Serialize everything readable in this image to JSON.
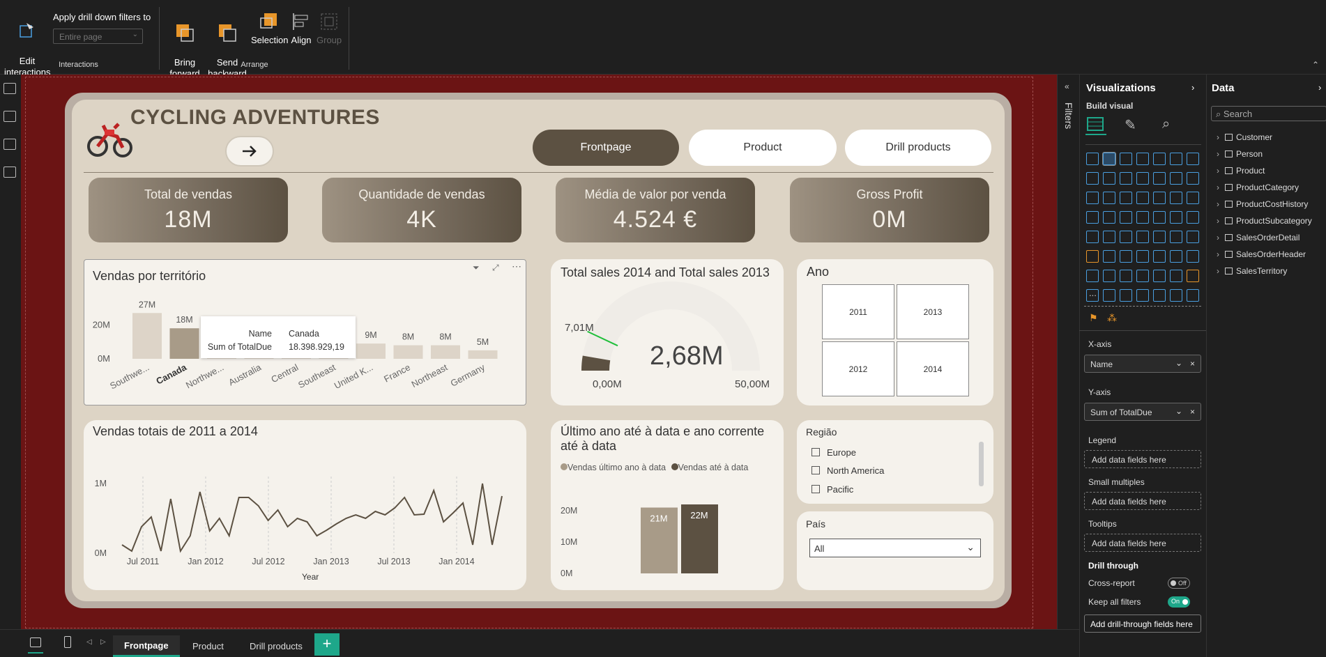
{
  "ribbon": {
    "edit_interactions": "Edit\ninteractions",
    "apply_drill": "Apply drill down filters to",
    "drill_placeholder": "Entire page",
    "interactions_group": "Interactions",
    "bring_forward": "Bring\nforward",
    "send_backward": "Send\nbackward",
    "selection": "Selection",
    "align": "Align",
    "group": "Group",
    "arrange_group": "Arrange"
  },
  "report": {
    "title": "CYCLING ADVENTURES",
    "nav": [
      "Frontpage",
      "Product",
      "Drill products"
    ],
    "kpis": [
      {
        "label": "Total de vendas",
        "value": "18M"
      },
      {
        "label": "Quantidade de vendas",
        "value": "4K"
      },
      {
        "label": "Média de valor por venda",
        "value": "4.524 €"
      },
      {
        "label": "Gross Profit",
        "value": "0M"
      }
    ],
    "bar_chart": {
      "title": "Vendas por território",
      "tooltip": {
        "name_label": "Name",
        "name_value": "Canada",
        "sum_label": "Sum of TotalDue",
        "sum_value": "18.398.929,19"
      }
    },
    "gauge": {
      "title": "Total sales 2014 and Total sales 2013",
      "value_label": "2,68M",
      "target_label": "7,01M",
      "min_label": "0,00M",
      "max_label": "50,00M"
    },
    "ano_slicer": {
      "title": "Ano",
      "options": [
        "2011",
        "2013",
        "2012",
        "2014"
      ]
    },
    "line_chart": {
      "title": "Vendas totais de 2011 a 2014",
      "xlabel": "Year"
    },
    "ytd_chart": {
      "title": "Último ano até à data e ano corrente até à data",
      "legend": [
        "Vendas último ano à data",
        "Vendas até à data"
      ]
    },
    "regiao": {
      "title": "Região",
      "options": [
        "Europe",
        "North America",
        "Pacific"
      ]
    },
    "pais": {
      "title": "País",
      "value": "All"
    }
  },
  "chart_data": [
    {
      "type": "bar",
      "title": "Vendas por território",
      "categories": [
        "Southwe...",
        "Canada",
        "Northwe...",
        "Australia",
        "Central",
        "Southeast",
        "United K...",
        "France",
        "Northeast",
        "Germany"
      ],
      "values": [
        27,
        18,
        18,
        12,
        9,
        9,
        9,
        8,
        8,
        5
      ],
      "data_labels": [
        "27M",
        "18M",
        "18M",
        "",
        "",
        "",
        "9M",
        "8M",
        "8M",
        "5M"
      ],
      "y_ticks": [
        "0M",
        "20M"
      ],
      "ylim": [
        0,
        30
      ]
    },
    {
      "type": "gauge",
      "title": "Total sales 2014 and Total sales 2013",
      "value": 2.68,
      "target": 7.01,
      "min": 0,
      "max": 50
    },
    {
      "type": "line",
      "title": "Vendas totais de 2011 a 2014",
      "xlabel": "Year",
      "x_ticks": [
        "Jul 2011",
        "Jan 2012",
        "Jul 2012",
        "Jan 2013",
        "Jul 2013",
        "Jan 2014"
      ],
      "y_ticks": [
        "0M",
        "1M"
      ],
      "ylim": [
        0,
        1.2
      ],
      "values": [
        0.12,
        0.03,
        0.38,
        0.52,
        0.03,
        0.78,
        0.03,
        0.25,
        0.88,
        0.32,
        0.5,
        0.25,
        0.8,
        0.8,
        0.68,
        0.47,
        0.62,
        0.38,
        0.5,
        0.45,
        0.25,
        0.33,
        0.42,
        0.5,
        0.55,
        0.5,
        0.6,
        0.55,
        0.65,
        0.8,
        0.55,
        0.56,
        0.9,
        0.45,
        0.58,
        0.72,
        0.12,
        1.0,
        0.12,
        0.82
      ]
    },
    {
      "type": "bar",
      "title": "Último ano até à data e ano corrente até à data",
      "categories": [
        "Vendas último ano à data",
        "Vendas até à data"
      ],
      "values": [
        21,
        22
      ],
      "data_labels": [
        "21M",
        "22M"
      ],
      "y_ticks": [
        "0M",
        "10M",
        "20M"
      ],
      "ylim": [
        0,
        25
      ],
      "colors": [
        "#a89b88",
        "#5c5142"
      ]
    }
  ],
  "viz_pane": {
    "title": "Visualizations",
    "build_visual": "Build visual",
    "more": "...",
    "xaxis_label": "X-axis",
    "xaxis_field": "Name",
    "yaxis_label": "Y-axis",
    "yaxis_field": "Sum of TotalDue",
    "legend_label": "Legend",
    "small_multiples_label": "Small multiples",
    "tooltips_label": "Tooltips",
    "add_fields": "Add data fields here",
    "drill_through": "Drill through",
    "cross_report": "Cross-report",
    "cross_report_state": "Off",
    "keep_filters": "Keep all filters",
    "keep_filters_state": "On",
    "add_drill": "Add drill-through fields here"
  },
  "filters_pane": {
    "label": "Filters"
  },
  "data_pane": {
    "title": "Data",
    "search_placeholder": "Search",
    "tables": [
      "Customer",
      "Person",
      "Product",
      "ProductCategory",
      "ProductCostHistory",
      "ProductSubcategory",
      "SalesOrderDetail",
      "SalesOrderHeader",
      "SalesTerritory"
    ]
  },
  "page_tabs": [
    "Frontpage",
    "Product",
    "Drill products"
  ],
  "colors": {
    "accent_green": "#1ea78a",
    "canvas": "#6b1414",
    "brown": "#5c5142"
  }
}
